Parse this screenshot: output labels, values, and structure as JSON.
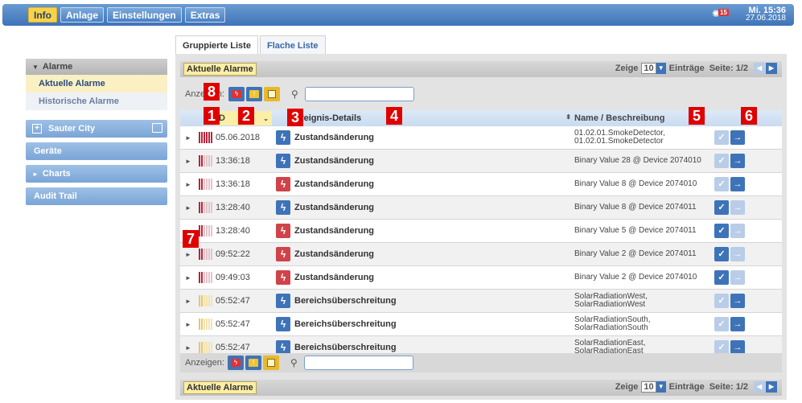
{
  "topbar": {
    "nav": [
      "Info",
      "Anlage",
      "Einstellungen",
      "Extras"
    ],
    "alarm_count": "15",
    "time": "Mi. 15:36",
    "date": "27.06.2018"
  },
  "sidebar": {
    "section": "Alarme",
    "items": [
      {
        "label": "Aktuelle Alarme"
      },
      {
        "label": "Historische Alarme"
      }
    ],
    "blocks": [
      "Sauter City",
      "Geräte",
      "Charts",
      "Audit Trail"
    ]
  },
  "tabs": [
    "Gruppierte Liste",
    "Flache Liste"
  ],
  "header": {
    "title": "Aktuelle Alarme",
    "show_label": "Zeige",
    "page_size": "10",
    "entries_label": "Einträge",
    "page": "Seite: 1/2"
  },
  "filter": {
    "label": "Anzeigen:",
    "search_value": ""
  },
  "columns": {
    "date": "D",
    "event": "Ereignis-Details",
    "name": "Name / Beschreibung"
  },
  "rows": [
    {
      "date": "05.06.2018",
      "event": "Zustandsänderung",
      "name1": "01.02.01.SmokeDetector,",
      "name2": "01.02.01.SmokeDetector",
      "type": "blue",
      "bar": "red-full",
      "ack": false
    },
    {
      "date": "13:36:18",
      "event": "Zustandsänderung",
      "name1": "Binary Value 28 @ Device 2074010",
      "name2": "",
      "type": "blue",
      "bar": "red",
      "ack": false
    },
    {
      "date": "13:36:18",
      "event": "Zustandsänderung",
      "name1": "Binary Value 8 @ Device 2074010",
      "name2": "",
      "type": "red",
      "bar": "red",
      "ack": false
    },
    {
      "date": "13:28:40",
      "event": "Zustandsänderung",
      "name1": "Binary Value 8 @ Device 2074011",
      "name2": "",
      "type": "blue",
      "bar": "red",
      "ack": true
    },
    {
      "date": "13:28:40",
      "event": "Zustandsänderung",
      "name1": "Binary Value 5 @ Device 2074011",
      "name2": "",
      "type": "red",
      "bar": "red",
      "ack": true
    },
    {
      "date": "09:52:22",
      "event": "Zustandsänderung",
      "name1": "Binary Value 2 @ Device 2074011",
      "name2": "",
      "type": "red",
      "bar": "red",
      "ack": true
    },
    {
      "date": "09:49:03",
      "event": "Zustandsänderung",
      "name1": "Binary Value 2 @ Device 2074010",
      "name2": "",
      "type": "red",
      "bar": "red",
      "ack": true
    },
    {
      "date": "05:52:47",
      "event": "Bereichsüberschreitung",
      "name1": "SolarRadiationWest,",
      "name2": "SolarRadiationWest",
      "type": "blue",
      "bar": "yellow",
      "ack": false
    },
    {
      "date": "05:52:47",
      "event": "Bereichsüberschreitung",
      "name1": "SolarRadiationSouth,",
      "name2": "SolarRadiationSouth",
      "type": "blue",
      "bar": "yellow",
      "ack": false
    },
    {
      "date": "05:52:47",
      "event": "Bereichsüberschreitung",
      "name1": "SolarRadiationEast,",
      "name2": "SolarRadiationEast",
      "type": "blue",
      "bar": "yellow",
      "ack": false
    }
  ],
  "markers": [
    "1",
    "2",
    "3",
    "4",
    "5",
    "6",
    "7",
    "8"
  ],
  "colors": {
    "accent": "#3e73b8",
    "alarm_red": "#d0434a",
    "warning_yellow": "#f1c232",
    "highlight": "#fbeea6"
  }
}
